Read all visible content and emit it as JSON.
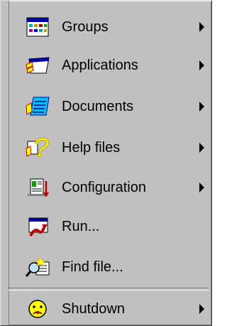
{
  "menu": {
    "items": [
      {
        "label": "Groups",
        "icon": "groups-icon",
        "submenu": true
      },
      {
        "label": "Applications",
        "icon": "applications-icon",
        "submenu": true
      },
      {
        "label": "Documents",
        "icon": "documents-icon",
        "submenu": true
      },
      {
        "label": "Help files",
        "icon": "help-files-icon",
        "submenu": true
      },
      {
        "label": "Configuration",
        "icon": "configuration-icon",
        "submenu": true
      },
      {
        "label": "Run...",
        "icon": "run-icon",
        "submenu": false
      },
      {
        "label": "Find file...",
        "icon": "find-file-icon",
        "submenu": false
      }
    ],
    "shutdown": {
      "label": "Shutdown",
      "icon": "shutdown-icon",
      "submenu": true
    }
  },
  "colors": {
    "menu_bg": "#c0c0c0",
    "text": "#000000",
    "accent_blue": "#0000c0",
    "accent_yellow": "#ffff00",
    "accent_red": "#c00000"
  }
}
